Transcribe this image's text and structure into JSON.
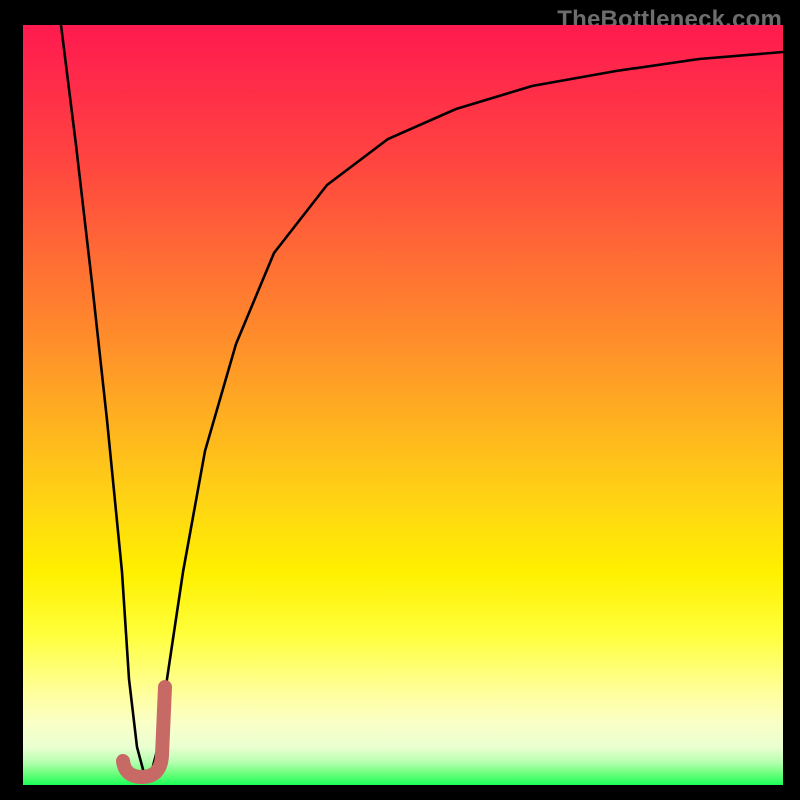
{
  "watermark": "TheBottleneck.com",
  "colors": {
    "frame": "#000000",
    "curve": "#000000",
    "marker": "#c76a66",
    "gradient_top": "#ff1a4f",
    "gradient_bottom": "#1aff57"
  },
  "chart_data": {
    "type": "line",
    "title": "",
    "xlabel": "",
    "ylabel": "",
    "xlim": [
      0,
      100
    ],
    "ylim": [
      0,
      100
    ],
    "note": "Axes have no tick labels in the image; values are normalized 0–100 estimates read from pixel positions. y = bottleneck % (100 = top/red, 0 = bottom/green). x = horizontal position.",
    "series": [
      {
        "name": "bottleneck-curve",
        "x": [
          5,
          7,
          9,
          11,
          13,
          14,
          15,
          16,
          17,
          18,
          19,
          21,
          24,
          28,
          33,
          40,
          48,
          57,
          67,
          78,
          89,
          100
        ],
        "y": [
          100,
          84,
          66,
          48,
          28,
          14,
          5,
          1,
          2,
          6,
          14,
          28,
          44,
          58,
          70,
          79,
          85,
          89,
          92,
          94,
          95.5,
          96.5
        ]
      }
    ],
    "marker": {
      "name": "optimal-point-J",
      "shape": "J",
      "center_x": 16,
      "center_y": 3,
      "extent_x": [
        13.5,
        19
      ],
      "extent_y": [
        0,
        13
      ]
    }
  }
}
